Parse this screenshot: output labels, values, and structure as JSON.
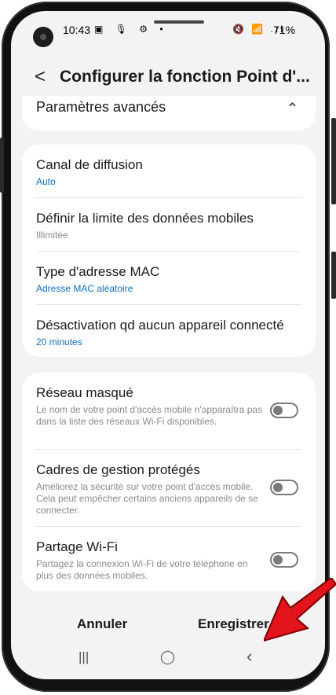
{
  "status_bar": {
    "time": "10:43",
    "icons_left": "▣ 🎙 ⚙ •",
    "icons_right": "🔇 📶 .ıl",
    "battery": "71%"
  },
  "header": {
    "title": "Configurer la fonction Point d'..."
  },
  "advanced": {
    "label": "Paramètres avancés"
  },
  "settings": [
    {
      "title": "Canal de diffusion",
      "value": "Auto"
    },
    {
      "title": "Définir la limite des données mobiles",
      "value": "Illimitée"
    },
    {
      "title": "Type d'adresse MAC",
      "value": "Adresse MAC aléatoire"
    },
    {
      "title": "Désactivation qd aucun appareil connecté",
      "value": "20 minutes"
    }
  ],
  "toggles": [
    {
      "title": "Réseau masqué",
      "desc": "Le nom de votre point d'accès mobile n'apparaîtra pas dans la liste des réseaux Wi-Fi disponibles.",
      "on": false
    },
    {
      "title": "Cadres de gestion protégés",
      "desc": "Améliorez la sécurité sur votre point d'accès mobile. Cela peut empêcher certains anciens appareils de se connecter.",
      "on": false
    },
    {
      "title": "Partage Wi-Fi",
      "desc": "Partagez la connexion Wi-Fi de votre téléphone en plus des données mobiles.",
      "on": false
    }
  ],
  "buttons": {
    "cancel": "Annuler",
    "save": "Enregistrer"
  },
  "nav": {
    "recents": "|||",
    "home": "◯",
    "back": "‹"
  },
  "colors": {
    "accent": "#0b6fc1",
    "arrow": "#e3141c"
  }
}
